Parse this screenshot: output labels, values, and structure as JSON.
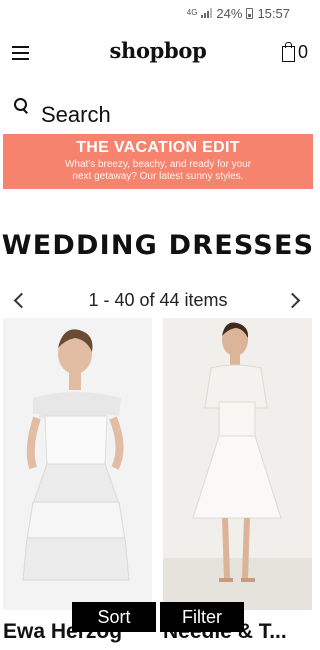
{
  "status_bar": {
    "network": "4G",
    "battery": "24%",
    "time": "15:57"
  },
  "header": {
    "logo": "shopbop",
    "bag_count": "0"
  },
  "search": {
    "label": "Search"
  },
  "promo": {
    "title": "THE VACATION EDIT",
    "subtitle": "What's breezy, beachy, and ready for your next getaway? Our latest sunny styles."
  },
  "page": {
    "title": "WEDDING DRESSES"
  },
  "pager": {
    "text": "1 - 40 of 44 items"
  },
  "products": [
    {
      "name": "Ewa Herzog"
    },
    {
      "name": "Needle & T..."
    }
  ],
  "actions": {
    "sort": "Sort",
    "filter": "Filter"
  },
  "colors": {
    "promo_bg": "#f6836e",
    "action_bg": "#000000"
  }
}
